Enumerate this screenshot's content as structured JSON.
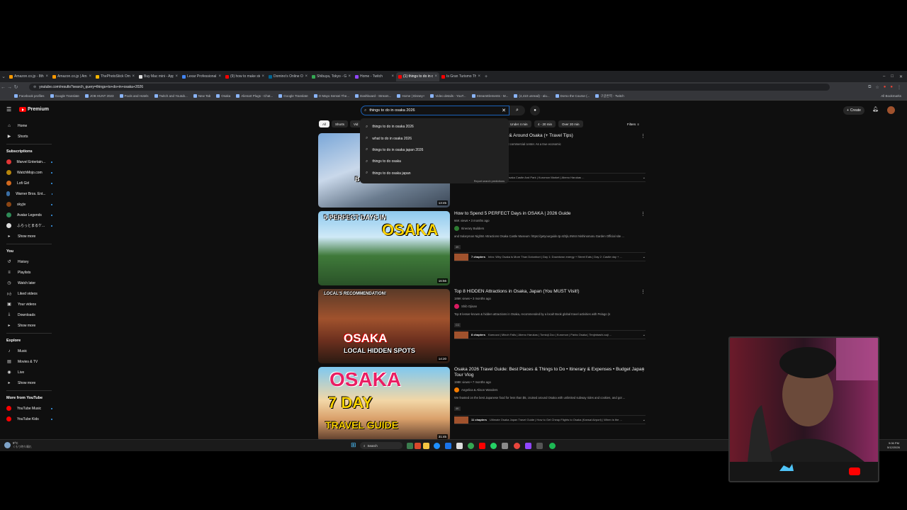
{
  "browser": {
    "tabs": [
      {
        "label": "Amazon.co.jp - 8th hdd",
        "color": "#ff9900"
      },
      {
        "label": "Amazon.co.jp | Amazon.co.jp",
        "color": "#ff9900"
      },
      {
        "label": "ThePhotoStick Omni 128B, Ph",
        "color": "#f4b400"
      },
      {
        "label": "Buy Mac mini - Apple",
        "color": "#dddddd"
      },
      {
        "label": "Lexar Professional Go Portab",
        "color": "#4285f4"
      },
      {
        "label": "(9) how to make steak fritas",
        "color": "#ff0000"
      },
      {
        "label": "Domino's Online Ordering",
        "color": "#006491"
      },
      {
        "label": "Shibuya, Tokyo - Google Maps",
        "color": "#34a853"
      },
      {
        "label": "Home - Twitch",
        "color": "#9146ff"
      },
      {
        "label": "(1) things to do in osaka 2026",
        "color": "#ff0000",
        "active": true
      },
      {
        "label": "Is Gran Turismo The Best Sim",
        "color": "#ff0000"
      }
    ],
    "new_tab": "+",
    "url": "youtube.com/results?search_query=things+to+do+in+osaka+2026",
    "bookmarks": [
      "Facebook profiles",
      "Google Translate",
      "JOB HUNT 2023",
      "Pools and Hotels",
      "Twitch and Youtub...",
      "New Tab",
      "Osaka",
      "Alienart Plugs - Chat...",
      "Google Translate",
      "O Mayo Sensei The...",
      "Dashboard - Stream...",
      "Home | Disney+",
      "Video details - YouT...",
      "StreamElements - M...",
      "(4,410 unread) - alu...",
      "Domo the Course (...",
      "구글번역 - Twitch"
    ],
    "all_bookmarks": "All Bookmarks"
  },
  "youtube": {
    "logo_label": "Premium",
    "search_value": "things to do in osaka 2026",
    "create_label": "Create",
    "suggestions": [
      "things to do in osaka 2026",
      "what to do in osaka 2026",
      "things to do in osaka japan 2026",
      "things to do osaka",
      "things to do osaka japan"
    ],
    "report": "Report search predictions",
    "chips": [
      {
        "label": "All",
        "selected": true
      },
      {
        "label": "Shorts"
      },
      {
        "label": "Vid"
      },
      {
        "label": "Under 4 min"
      },
      {
        "label": "4 - 20 min"
      },
      {
        "label": "Over 20 min"
      }
    ],
    "filters_label": "Filters",
    "sidebar": {
      "main": [
        {
          "label": "Home",
          "icon": "home-icon"
        },
        {
          "label": "Shorts",
          "icon": "shorts-icon"
        }
      ],
      "subscriptions_header": "Subscriptions",
      "subscriptions": [
        {
          "label": "Marvel Entertain...",
          "color": "#e23636"
        },
        {
          "label": "WatchMojo.com",
          "color": "#b8860b"
        },
        {
          "label": "Lofi Girl",
          "color": "#d2691e"
        },
        {
          "label": "Warner Bros. Ent...",
          "color": "#3a6ea5"
        },
        {
          "label": "skyjiv",
          "color": "#8b4513"
        },
        {
          "label": "Avatar Legends",
          "color": "#2e8b57"
        },
        {
          "label": "ふらっとまるケ...",
          "color": "#dddddd"
        }
      ],
      "show_more": "Show more",
      "you_header": "You",
      "you": [
        {
          "label": "History",
          "icon": "history-icon"
        },
        {
          "label": "Playlists",
          "icon": "playlists-icon"
        },
        {
          "label": "Watch later",
          "icon": "watch-later-icon"
        },
        {
          "label": "Liked videos",
          "icon": "liked-icon"
        },
        {
          "label": "Your videos",
          "icon": "your-videos-icon"
        },
        {
          "label": "Downloads",
          "icon": "downloads-icon"
        }
      ],
      "explore_header": "Explore",
      "explore": [
        {
          "label": "Music",
          "icon": "music-icon"
        },
        {
          "label": "Movies & TV",
          "icon": "movies-icon"
        },
        {
          "label": "Live",
          "icon": "live-icon"
        }
      ],
      "more_header": "More from YouTube",
      "more": [
        {
          "label": "YouTube Music"
        },
        {
          "label": "YouTube Kids"
        }
      ]
    },
    "results": [
      {
        "title": "Awesome Things To Do In & Around Osaka (+ Travel Tips)",
        "meta": "",
        "channel": "",
        "description": "Japan's third-largest city and an important commercial center. As a true economic",
        "duration": "13:45",
        "thumb_text": "Best Things To Do",
        "chapters_count": "",
        "chapters_text": "tle | Tompkins And Shrines | Osaka Castle And Park | Kuromon Market | Abeno Harukas ..."
      },
      {
        "title": "How to Spend 5 PERFECT Days in OSAKA | 2026 Guide",
        "meta": "66K views • 3 months ago",
        "channel": "Itinerary Builders",
        "description": "and Salaryman Nights! Attractions Osaka Castle Museum: https://getyourguide.tp.st/2jiLXW44 Nishinomaru Garden Official site ...",
        "cc": "4K",
        "duration": "16:56",
        "thumb_top": "5 PERFECT DAYS IN",
        "thumb_text": "OSAKA",
        "chapters_count": "7 chapters",
        "chapters_text": "Intro: Why Osaka is More Than Dotonbori | Day 1: Downtown energy + Street Eats | Day 2: Castle day + ..."
      },
      {
        "title": "Top 8 HIDDEN Attractions in Osaka, Japan (You MUST Visit!)",
        "meta": "186K views • 3 months ago",
        "channel": "Shib Ojisan",
        "description": "Top 8 lesser-known & hidden attractions in Osaka, recommended by a local! Book global travel activities with Pelago (s",
        "cc": "CC",
        "duration": "14:20",
        "thumb_top": "LOCAL'S RECOMMENDATION!",
        "thumb_text": "OSAKA",
        "thumb_bottom": "LOCAL HIDDEN SPOTS",
        "chapters_count": "8 chapters",
        "chapters_text": "Kamozai | Minoh Falls | Abeno Harukas | Tomioji Zoo | Kuromon | Parks Osaka | Tenjinbashi-suji ..."
      },
      {
        "title": "Osaka 2026 Travel Guide: Best Places & Things to Do • Itinerary & Expenses • Budget Japan Tour Vlog",
        "meta": "198K views • 7 months ago",
        "channel": "Angelica & Alison Wanders",
        "description": "We feasted on the best Japanese food for less than $5, cruised around Osaka with unlimited subway rides and cookies, and got ...",
        "cc": "4K",
        "duration": "31:45",
        "thumb_text": "OSAKA",
        "thumb_mid": "7 DAY",
        "thumb_bottom": "TRAVEL GUIDE",
        "chapters_count": "11 chapters",
        "chapters_text": "Ultimate Osaka Japan Travel Guide | How to Get Cheap Flights to Osaka (Kansai Airport) | When is the ..."
      }
    ]
  },
  "taskbar": {
    "search_label": "Search",
    "weather_temp": "9°C",
    "weather_desc": "くもり時々晴れ",
    "time": "9:06 PM",
    "date": "5/12/2026"
  },
  "colors": {
    "yt_red": "#ff0000",
    "bg": "#0f0f0f",
    "accent_blue": "#3ea6ff"
  }
}
